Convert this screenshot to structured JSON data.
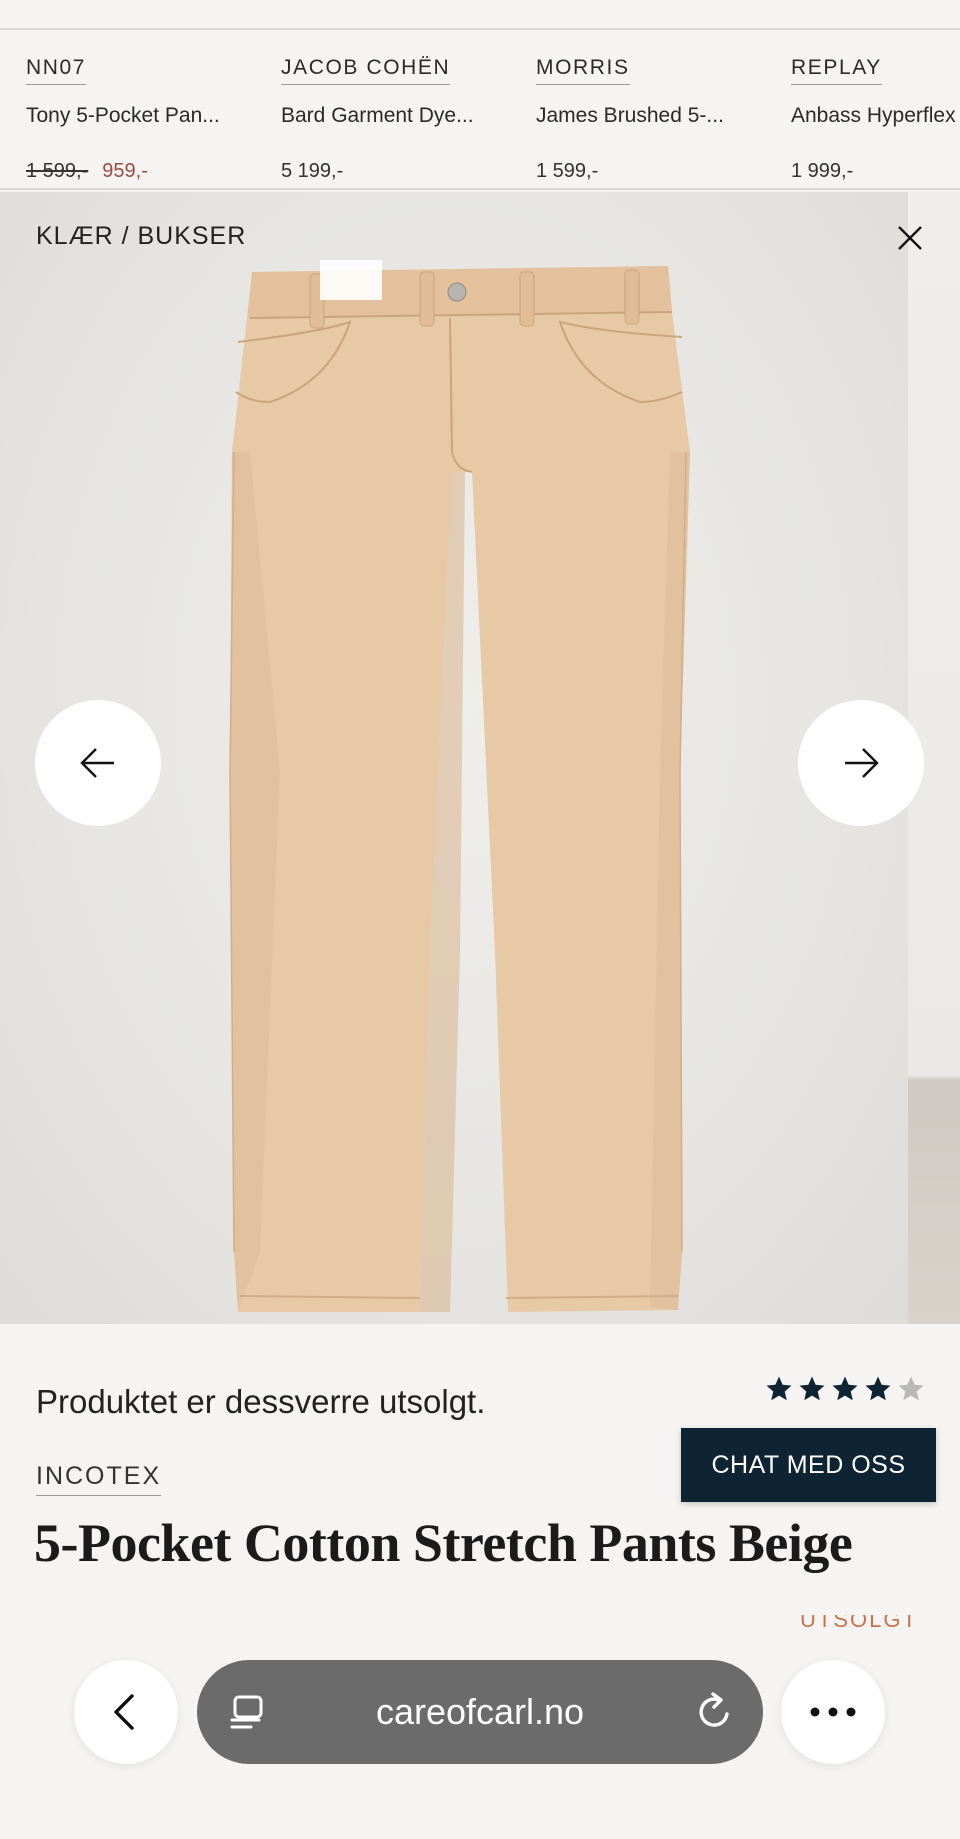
{
  "related_products": [
    {
      "brand": "NN07",
      "name": "Tony 5-Pocket Pan...",
      "old_price": "1 599,-",
      "price": "959,-"
    },
    {
      "brand": "JACOB COHËN",
      "name": "Bard Garment Dye...",
      "old_price": "",
      "price": "5 199,-"
    },
    {
      "brand": "MORRIS",
      "name": "James Brushed 5-...",
      "old_price": "",
      "price": "1 599,-"
    },
    {
      "brand": "REPLAY",
      "name": "Anbass Hyperflex",
      "old_price": "",
      "price": "1 999,-"
    }
  ],
  "gallery": {
    "breadcrumb": "KLÆR / BUKSER",
    "close_icon": "close-icon",
    "prev_icon": "arrow-left-icon",
    "next_icon": "arrow-right-icon",
    "image_description": "beige 5-pocket pants product photo"
  },
  "product": {
    "soldout_message": "Produktet er dessverre utsolgt.",
    "rating": 4,
    "rating_max": 5,
    "brand": "INCOTEX",
    "title": "5-Pocket Cotton Stretch Pants Beige",
    "status": "UTSOLGT"
  },
  "chat": {
    "label": "CHAT MED OSS"
  },
  "browser": {
    "url": "careofcarl.no",
    "back_icon": "chevron-left-icon",
    "reader_icon": "reader-icon",
    "reload_icon": "reload-icon",
    "more_icon": "more-icon"
  },
  "colors": {
    "background": "#f5f4f2",
    "sale_price": "#9b4a45",
    "chat_button": "#0f2433",
    "url_pill": "#6b6b6b",
    "star_filled": "#0f2433",
    "star_empty": "#b9b9b9",
    "pants": "#e6c7a4"
  }
}
